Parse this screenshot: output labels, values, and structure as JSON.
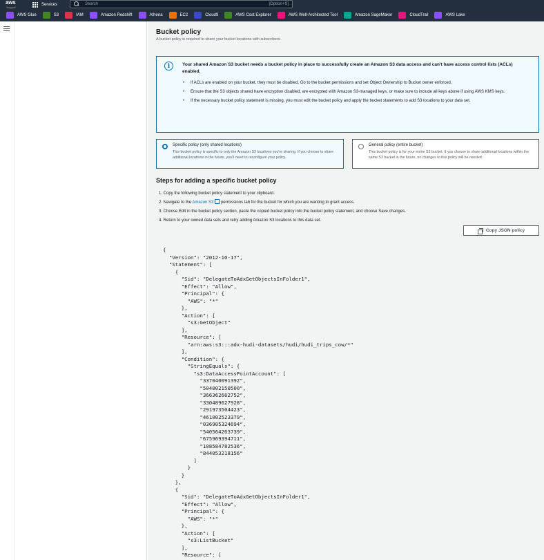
{
  "topnav": {
    "logo": "aws",
    "services_label": "Services",
    "search_placeholder": "Search",
    "search_shortcut": "[Option+S]"
  },
  "favorites": [
    {
      "label": "AWS Glue",
      "icon": "glue-icon",
      "color": "#8c4fff"
    },
    {
      "label": "S3",
      "icon": "s3-icon",
      "color": "#3f8624"
    },
    {
      "label": "IAM",
      "icon": "iam-icon",
      "color": "#dd344c"
    },
    {
      "label": "Amazon Redshift",
      "icon": "redshift-icon",
      "color": "#8c4fff"
    },
    {
      "label": "Athena",
      "icon": "athena-icon",
      "color": "#8c4fff"
    },
    {
      "label": "EC2",
      "icon": "ec2-icon",
      "color": "#ed7100"
    },
    {
      "label": "Cloud9",
      "icon": "cloud9-icon",
      "color": "#3b48cc"
    },
    {
      "label": "AWS Cost Explorer",
      "icon": "cost-explorer-icon",
      "color": "#3f8624"
    },
    {
      "label": "AWS Well-Architected Tool",
      "icon": "well-architected-icon",
      "color": "#e7157b"
    },
    {
      "label": "Amazon SageMaker",
      "icon": "sagemaker-icon",
      "color": "#01a88d"
    },
    {
      "label": "CloudTrail",
      "icon": "cloudtrail-icon",
      "color": "#e7157b"
    },
    {
      "label": "AWS Lake",
      "icon": "lake-formation-icon",
      "color": "#8c4fff"
    }
  ],
  "section": {
    "title": "Bucket policy",
    "description": "A bucket policy is required to share your bucket locations with subscribers."
  },
  "info": {
    "heading": "Your shared Amazon S3 bucket needs a bucket policy in place to successfully create an Amazon S3 data access and can't have access control lists (ACLs) enabled.",
    "bullets": [
      "If ACLs are enabled on your bucket, they must be disabled. Go to the bucket permissions and set Object Ownership to Bucket owner enforced.",
      "Ensure that the S3 objects shared have encryption disabled, are encrypted with Amazon S3-managed keys, or make sure to include all keys above if using AWS KMS keys.",
      "If the necessary bucket policy statement is missing, you must edit the bucket policy and apply the bucket statements to add S3 locations to your data set."
    ]
  },
  "options": {
    "specific": {
      "title": "Specific policy (only shared locations)",
      "description": "This bucket policy is specific to only the Amazon S3 locations you're sharing. If you choose to share additional locations in the future, you'll need to reconfigure your policy."
    },
    "general": {
      "title": "General policy (entire bucket)",
      "description": "This bucket policy is for your entire S3 bucket. If you choose to share additional locations within the same S3 bucket in the future, no changes to this policy will be needed."
    }
  },
  "steps": {
    "title": "Steps for adding a specific bucket policy",
    "step1": "1. Copy the following bucket policy statement to your clipboard.",
    "step2_prefix": "2. Navigate to the ",
    "step2_link": "Amazon S3",
    "step2_suffix": " permissions tab for the bucket for which you are wanting to grant access.",
    "step3": "3. Choose Edit in the bucket policy section, paste the copied bucket policy into the bucket policy statement, and choose Save changes.",
    "step4": "4. Return to your owned data sets and retry adding Amazon S3 locations to this data set."
  },
  "copy_button": "Copy JSON policy",
  "policy_json": "{\n  \"Version\": \"2012-10-17\",\n  \"Statement\": [\n    {\n      \"Sid\": \"DelegateToAdxGetObjectsInFolder1\",\n      \"Effect\": \"Allow\",\n      \"Principal\": {\n        \"AWS\": \"*\"\n      },\n      \"Action\": [\n        \"s3:GetObject\"\n      ],\n      \"Resource\": [\n        \"arn:aws:s3:::adx-hudi-datasets/hudi/hudi_trips_cow/*\"\n      ],\n      \"Condition\": {\n        \"StringEquals\": {\n          \"s3:DataAccessPointAccount\": [\n            \"337040091392\",\n            \"504002150500\",\n            \"366362662752\",\n            \"330489627928\",\n            \"291973504423\",\n            \"461002523379\",\n            \"036905324694\",\n            \"540564263739\",\n            \"675969394711\",\n            \"108584782536\",\n            \"844053218156\"\n          ]\n        }\n      }\n    },\n    {\n      \"Sid\": \"DelegateToAdxGetObjectsInFolder1\",\n      \"Effect\": \"Allow\",\n      \"Principal\": {\n        \"AWS\": \"*\"\n      },\n      \"Action\": [\n        \"s3:ListBucket\"\n      ],\n      \"Resource\": ["
}
